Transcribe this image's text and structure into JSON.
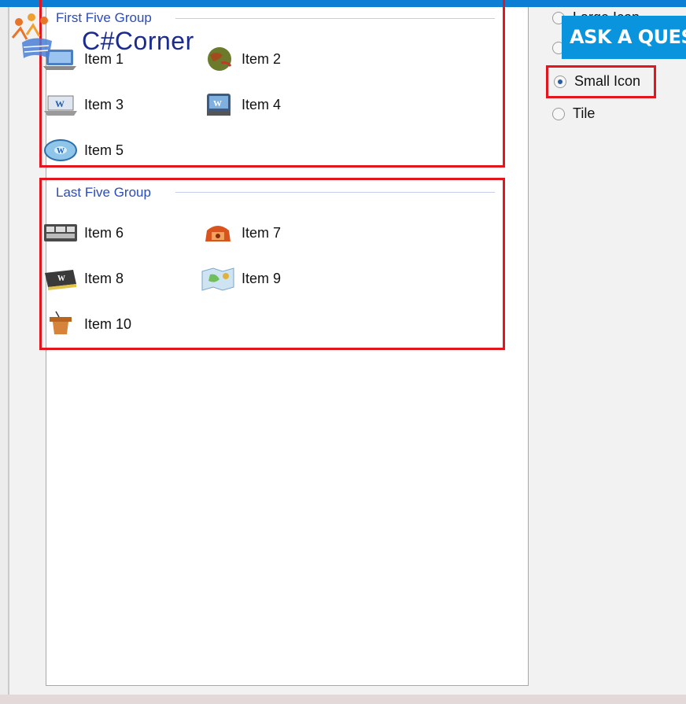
{
  "watermark": {
    "logo_text": "C#Corner",
    "banner_text": "ASK A QUES"
  },
  "listview": {
    "groups": [
      {
        "header": "First Five Group",
        "items": [
          {
            "label": "Item 1",
            "icon": "laptop-icon"
          },
          {
            "label": "Item 2",
            "icon": "globe-icon"
          },
          {
            "label": "Item 3",
            "icon": "word-laptop-icon"
          },
          {
            "label": "Item 4",
            "icon": "word-drive-icon"
          },
          {
            "label": "Item 5",
            "icon": "word-disc-icon"
          }
        ]
      },
      {
        "header": "Last Five Group",
        "items": [
          {
            "label": "Item 6",
            "icon": "word-keyboard-icon"
          },
          {
            "label": "Item 7",
            "icon": "phone-icon"
          },
          {
            "label": "Item 8",
            "icon": "word-book-icon"
          },
          {
            "label": "Item 9",
            "icon": "map-icon"
          },
          {
            "label": "Item 10",
            "icon": "podium-icon"
          }
        ]
      }
    ]
  },
  "view_options": {
    "options": [
      {
        "label": "Large Icon",
        "checked": false
      },
      {
        "label": "",
        "checked": false
      },
      {
        "label": "Small Icon",
        "checked": true
      },
      {
        "label": "Tile",
        "checked": false
      }
    ]
  },
  "colors": {
    "highlight": "#e3151e",
    "group_header": "#2a4bbd",
    "banner": "#0b94de",
    "topbar": "#0b7fd4"
  }
}
